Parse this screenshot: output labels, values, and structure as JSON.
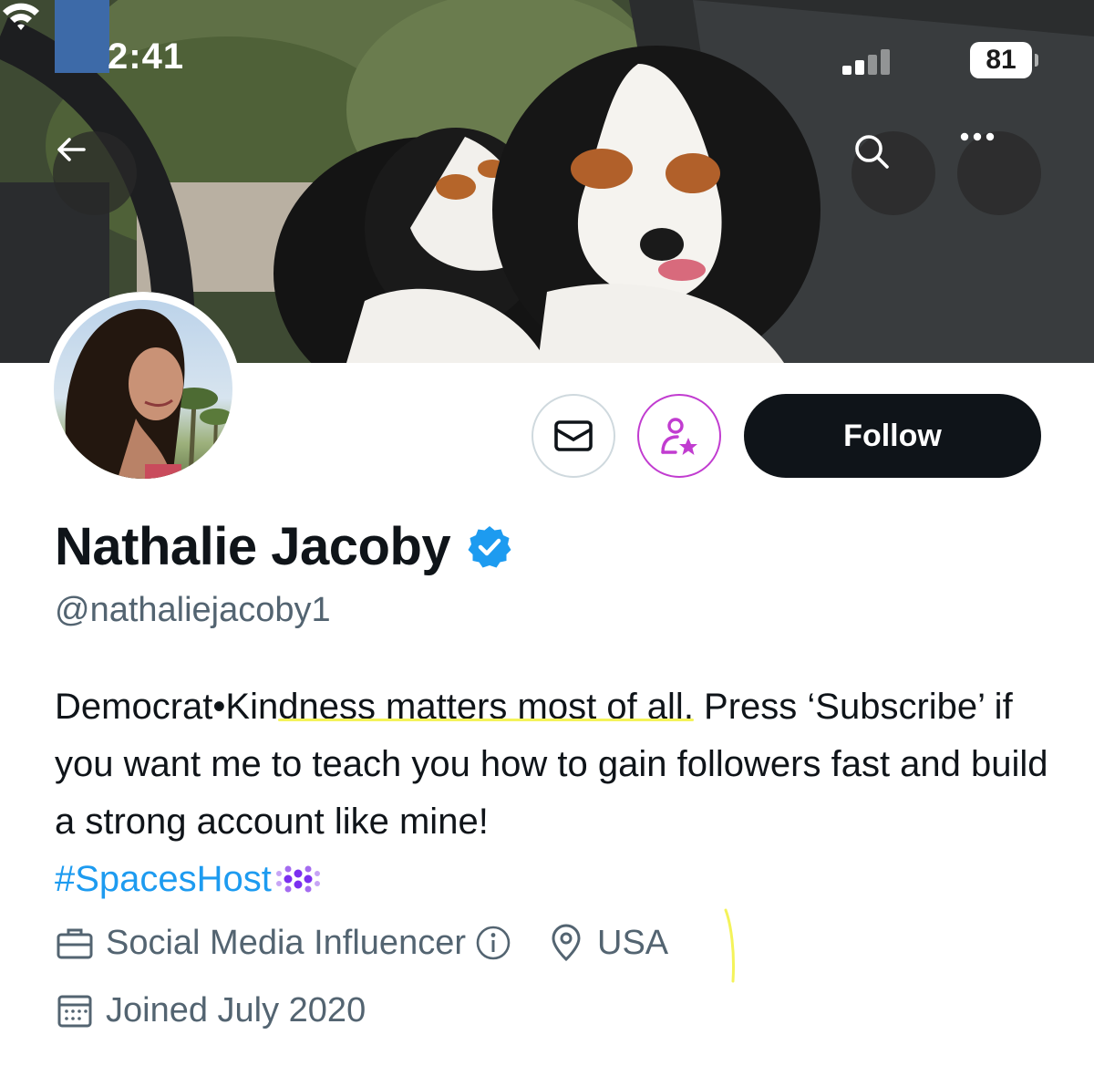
{
  "status_bar": {
    "time": "2:41",
    "battery": "81"
  },
  "header": {
    "back_icon": "arrow-left-icon",
    "search_icon": "search-icon",
    "more_icon": "more-horizontal-icon"
  },
  "actions": {
    "message_icon": "envelope-icon",
    "subscribe_icon": "person-star-icon",
    "follow_label": "Follow",
    "subscribe_color": "#c13cd0"
  },
  "profile": {
    "display_name": "Nathalie Jacoby",
    "verified_color": "#1d9bf0",
    "handle": "@nathaliejacoby1",
    "bio_part1": "Democrat•Kin",
    "bio_highlight": "dness matters most of all.",
    "bio_part2": " Press ‘Subscribe’ if you want me to teach you how to gain followers fast and build a strong account like mine!",
    "hashtag": "#SpacesHost",
    "category": "Social Media Influencer",
    "location": "USA",
    "joined": "Joined July 2020"
  },
  "colors": {
    "text_primary": "#0f1419",
    "text_secondary": "#536471",
    "link": "#1d9bf0",
    "highlight_marker": "#f4f35a"
  }
}
